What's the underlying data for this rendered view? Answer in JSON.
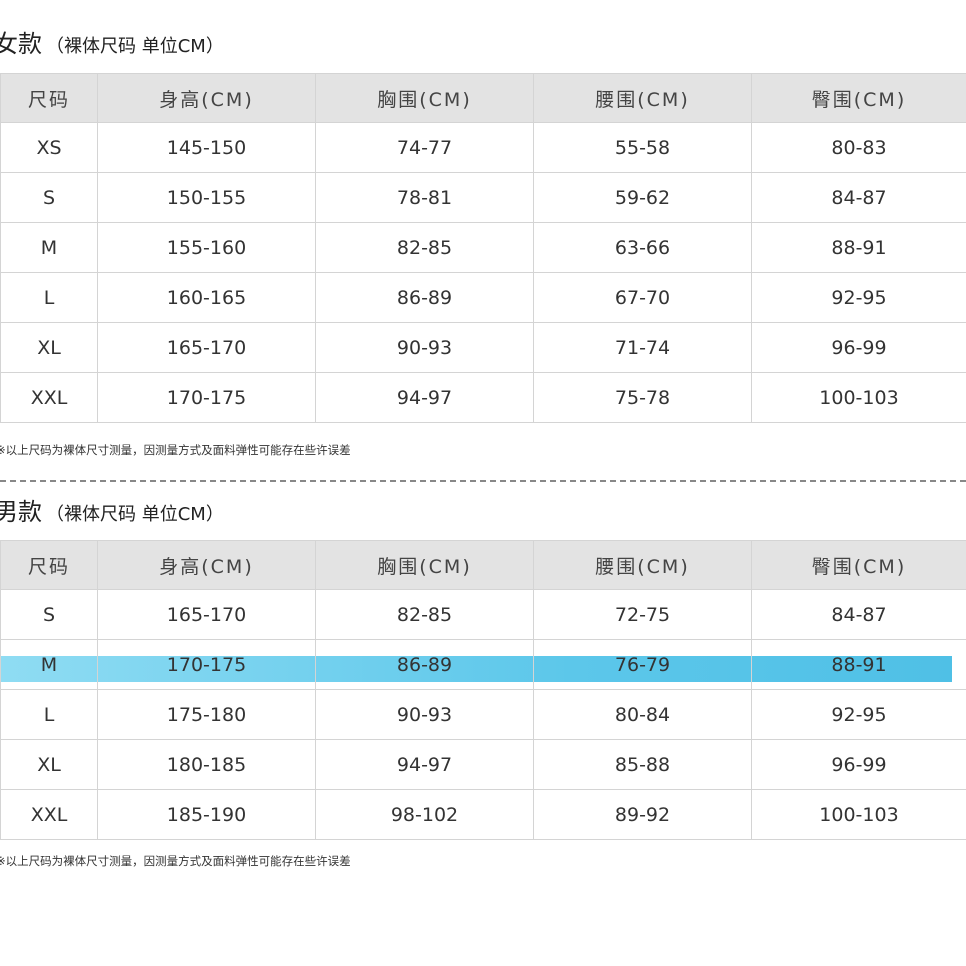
{
  "women": {
    "title": "女款",
    "subtitle": "（裸体尺码 单位CM）",
    "headers": [
      "尺码",
      "身高(CM)",
      "胸围(CM)",
      "腰围(CM)",
      "臀围(CM)"
    ],
    "rows": [
      [
        "XS",
        "145-150",
        "74-77",
        "55-58",
        "80-83"
      ],
      [
        "S",
        "150-155",
        "78-81",
        "59-62",
        "84-87"
      ],
      [
        "M",
        "155-160",
        "82-85",
        "63-66",
        "88-91"
      ],
      [
        "L",
        "160-165",
        "86-89",
        "67-70",
        "92-95"
      ],
      [
        "XL",
        "165-170",
        "90-93",
        "71-74",
        "96-99"
      ],
      [
        "XXL",
        "170-175",
        "94-97",
        "75-78",
        "100-103"
      ]
    ],
    "note": "※以上尺码为裸体尺寸测量，因测量方式及面料弹性可能存在些许误差"
  },
  "men": {
    "title": "男款",
    "subtitle": "（裸体尺码 单位CM）",
    "headers": [
      "尺码",
      "身高(CM)",
      "胸围(CM)",
      "腰围(CM)",
      "臀围(CM)"
    ],
    "rows": [
      [
        "S",
        "165-170",
        "82-85",
        "72-75",
        "84-87"
      ],
      [
        "M",
        "170-175",
        "86-89",
        "76-79",
        "88-91"
      ],
      [
        "L",
        "175-180",
        "90-93",
        "80-84",
        "92-95"
      ],
      [
        "XL",
        "180-185",
        "94-97",
        "85-88",
        "96-99"
      ],
      [
        "XXL",
        "185-190",
        "98-102",
        "89-92",
        "100-103"
      ]
    ],
    "highlighted_size": "M",
    "highlight_color": "#5cc7ea",
    "note": "※以上尺码为裸体尺寸测量，因测量方式及面料弹性可能存在些许误差"
  }
}
